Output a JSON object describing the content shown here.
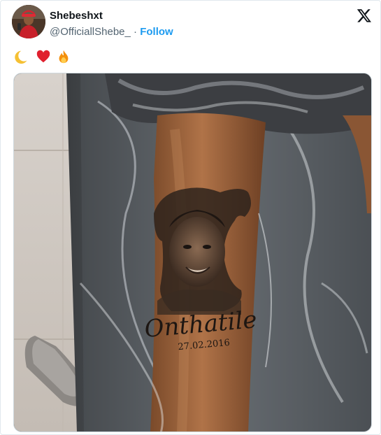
{
  "author": {
    "display_name": "Shebeshxt",
    "handle": "@OfficiallShebe_",
    "separator": "·",
    "follow_label": "Follow"
  },
  "tweet": {
    "emojis": [
      "crescent-moon",
      "red-heart",
      "fire"
    ]
  },
  "media": {
    "tattoo_name": "Onthatile",
    "tattoo_date": "27.02.2016"
  },
  "colors": {
    "accent": "#1d9bf0",
    "text": "#0f1419",
    "muted": "#536471"
  }
}
